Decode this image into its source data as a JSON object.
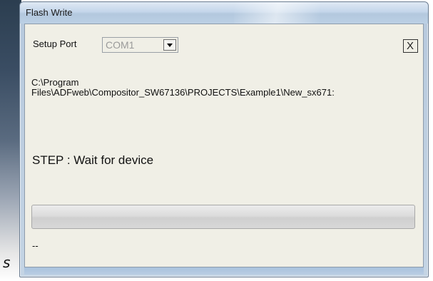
{
  "window": {
    "title": "Flash Write"
  },
  "setup": {
    "label": "Setup Port",
    "port_value": "COM1"
  },
  "close_button": {
    "label": "X"
  },
  "file_path": {
    "line1": "C:\\Program",
    "line2": "Files\\ADFweb\\Compositor_SW67136\\PROJECTS\\Example1\\New_sx671:"
  },
  "step": {
    "text": "STEP : Wait for device"
  },
  "progress": {
    "value": 0
  },
  "status": {
    "text": "--"
  },
  "background": {
    "glyph": "s"
  },
  "colors": {
    "titlebar": "#c4d6ea",
    "client_bg": "#f0efe6",
    "progress_fill": "#3cb043"
  }
}
